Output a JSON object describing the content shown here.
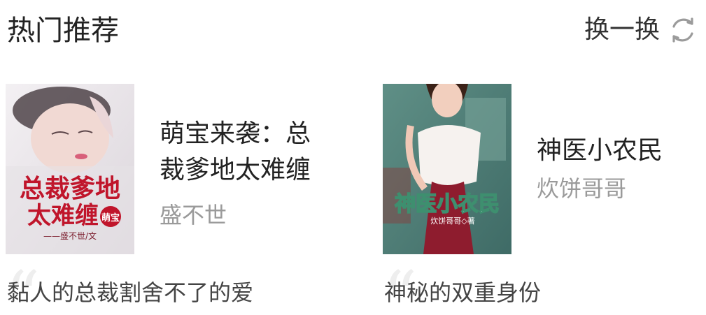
{
  "header": {
    "title": "热门推荐",
    "refresh_label": "换一换",
    "refresh_icon": "refresh-icon"
  },
  "books": [
    {
      "title": "萌宝来袭：总裁爹地太难缠",
      "author": "盛不世",
      "tagline": "黏人的总裁割舍不了的爱",
      "cover": {
        "title_line1": "总裁爹地",
        "title_line2": "太难缠",
        "badge": "萌宝",
        "author_line": "——盛不世/文",
        "accent": "#c0152b"
      }
    },
    {
      "title": "神医小农民",
      "author": "炊饼哥哥",
      "tagline": "神秘的双重身份",
      "cover": {
        "title_text": "神医小农民",
        "author_line": "炊饼哥哥◇著",
        "accent": "#ffffff"
      }
    }
  ]
}
